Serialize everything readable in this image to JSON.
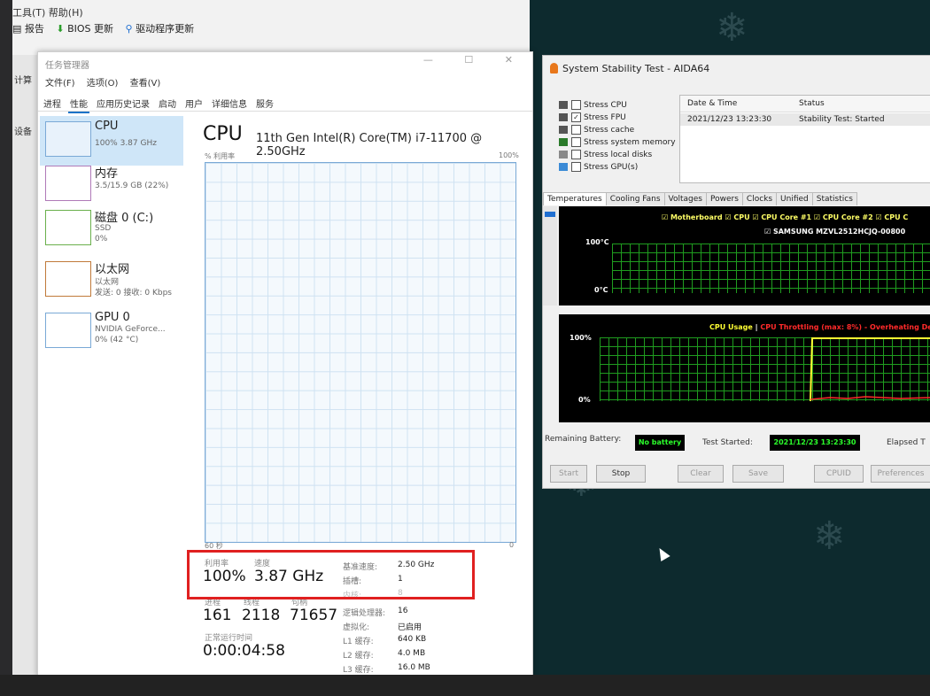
{
  "background_app": {
    "menu": "工具(T)  帮助(H)",
    "toolbar": [
      {
        "icon": "report-icon",
        "label": "报告"
      },
      {
        "icon": "download-arrow-icon",
        "label": "BIOS 更新"
      },
      {
        "icon": "search-icon",
        "label": "驱动程序更新"
      }
    ],
    "side_labels": [
      "计算",
      "设备"
    ]
  },
  "task_manager": {
    "title": "任务管理器",
    "window_buttons": "—  ☐  ✕",
    "menu": [
      "文件(F)",
      "选项(O)",
      "查看(V)"
    ],
    "tabs": [
      "进程",
      "性能",
      "应用历史记录",
      "启动",
      "用户",
      "详细信息",
      "服务"
    ],
    "active_tab": "性能",
    "sidebar": [
      {
        "name": "CPU",
        "line1": "100% 3.87 GHz",
        "line2": ""
      },
      {
        "name": "内存",
        "line1": "3.5/15.9 GB (22%)",
        "line2": ""
      },
      {
        "name": "磁盘 0 (C:)",
        "line1": "SSD",
        "line2": "0%"
      },
      {
        "name": "以太网",
        "line1": "以太网",
        "line2": "发送: 0 接收: 0 Kbps"
      },
      {
        "name": "GPU 0",
        "line1": "NVIDIA GeForce...",
        "line2": "0% (42 °C)"
      }
    ],
    "cpu": {
      "title": "CPU",
      "model": "11th Gen Intel(R) Core(TM) i7-11700 @ 2.50GHz",
      "graph_label": "% 利用率",
      "graph_max": "100%",
      "axis_left": "60 秒",
      "axis_right": "0",
      "utilization_label": "利用率",
      "utilization": "100%",
      "speed_label": "速度",
      "speed": "3.87 GHz",
      "processes_label": "进程",
      "processes": "161",
      "threads_label": "线程",
      "threads": "2118",
      "handles_label": "句柄",
      "handles": "71657",
      "uptime_label": "正常运行时间",
      "uptime": "0:00:04:58",
      "details": [
        {
          "k": "基准速度:",
          "v": "2.50 GHz"
        },
        {
          "k": "插槽:",
          "v": "1"
        },
        {
          "k": "内核:",
          "v": "8"
        },
        {
          "k": "逻辑处理器:",
          "v": "16"
        },
        {
          "k": "虚拟化:",
          "v": "已启用"
        },
        {
          "k": "L1 缓存:",
          "v": "640 KB"
        },
        {
          "k": "L2 缓存:",
          "v": "4.0 MB"
        },
        {
          "k": "L3 缓存:",
          "v": "16.0 MB"
        }
      ]
    }
  },
  "aida": {
    "title": "System Stability Test - AIDA64",
    "stress": [
      {
        "label": "Stress CPU",
        "checked": false
      },
      {
        "label": "Stress FPU",
        "checked": true
      },
      {
        "label": "Stress cache",
        "checked": false
      },
      {
        "label": "Stress system memory",
        "checked": false
      },
      {
        "label": "Stress local disks",
        "checked": false
      },
      {
        "label": "Stress GPU(s)",
        "checked": false
      }
    ],
    "log_headers": [
      "Date & Time",
      "Status"
    ],
    "log_row": {
      "datetime": "2021/12/23 13:23:30",
      "status": "Stability Test: Started"
    },
    "tabs": [
      "Temperatures",
      "Cooling Fans",
      "Voltages",
      "Powers",
      "Clocks",
      "Unified",
      "Statistics"
    ],
    "active_tab": "Temperatures",
    "temp_legend": "☑ Motherboard ☑ CPU ☑ CPU Core #1 ☑ CPU Core #2 ☑ CPU C",
    "temp_legend2": "☑ SAMSUNG MZVL2512HCJQ-00800",
    "temp_axis_top": "100°C",
    "temp_axis_bottom": "0°C",
    "usage_legend_a": "CPU Usage",
    "usage_legend_sep": " | ",
    "usage_legend_b": "CPU Throttling (max: 8%) - Overheating Dete",
    "usage_axis_top": "100%",
    "usage_axis_bottom": "0%",
    "remaining_battery_label": "Remaining Battery:",
    "battery_value": "No battery",
    "test_started_label": "Test Started:",
    "test_started_value": "2021/12/23 13:23:30",
    "elapsed_label": "Elapsed T",
    "buttons": [
      "Start",
      "Stop",
      "Clear",
      "Save",
      "CPUID",
      "Preferences"
    ],
    "colors": {
      "grid": "#1f9c1f",
      "usage_line": "#ffff33",
      "throttle_line": "#ff2a2a"
    }
  },
  "highlight_color": "#e02020"
}
